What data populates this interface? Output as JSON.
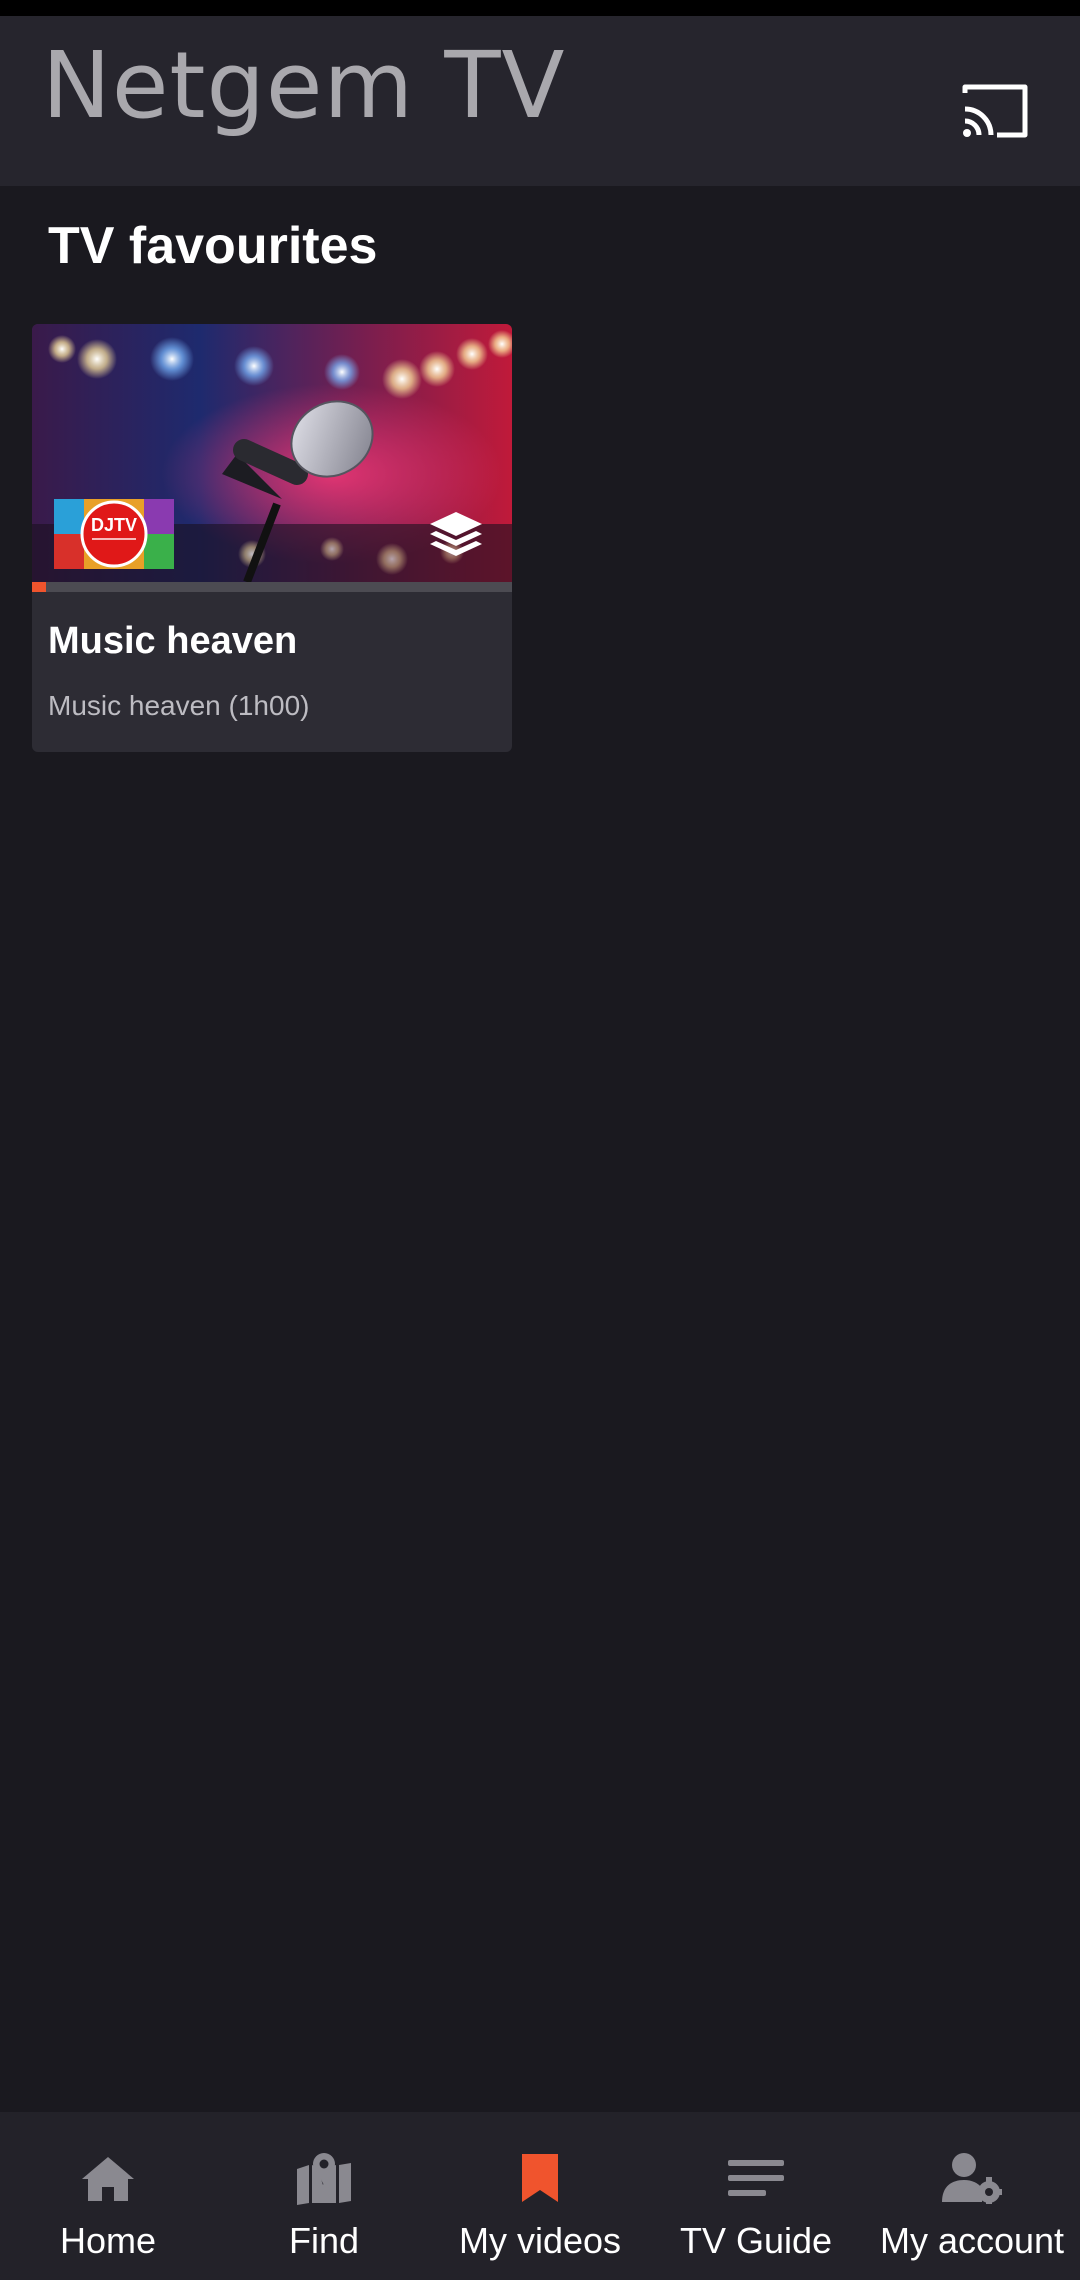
{
  "app": {
    "title": "Netgem TV"
  },
  "section": {
    "title": "TV favourites"
  },
  "cards": [
    {
      "title": "Music heaven",
      "subtitle": "Music heaven (1h00)",
      "channel_logo_text": "DJTV",
      "progress": 0.03
    }
  ],
  "nav": {
    "items": [
      {
        "label": "Home",
        "icon": "home-icon",
        "active": false
      },
      {
        "label": "Find",
        "icon": "map-pin-icon",
        "active": false
      },
      {
        "label": "My videos",
        "icon": "bookmark-icon",
        "active": true
      },
      {
        "label": "TV Guide",
        "icon": "list-icon",
        "active": false
      },
      {
        "label": "My account",
        "icon": "user-settings-icon",
        "active": false
      }
    ]
  },
  "colors": {
    "accent": "#f0542d",
    "background": "#1a191f",
    "appbar": "#26252d",
    "card": "#2d2c34",
    "icon_inactive": "#8a8990"
  }
}
